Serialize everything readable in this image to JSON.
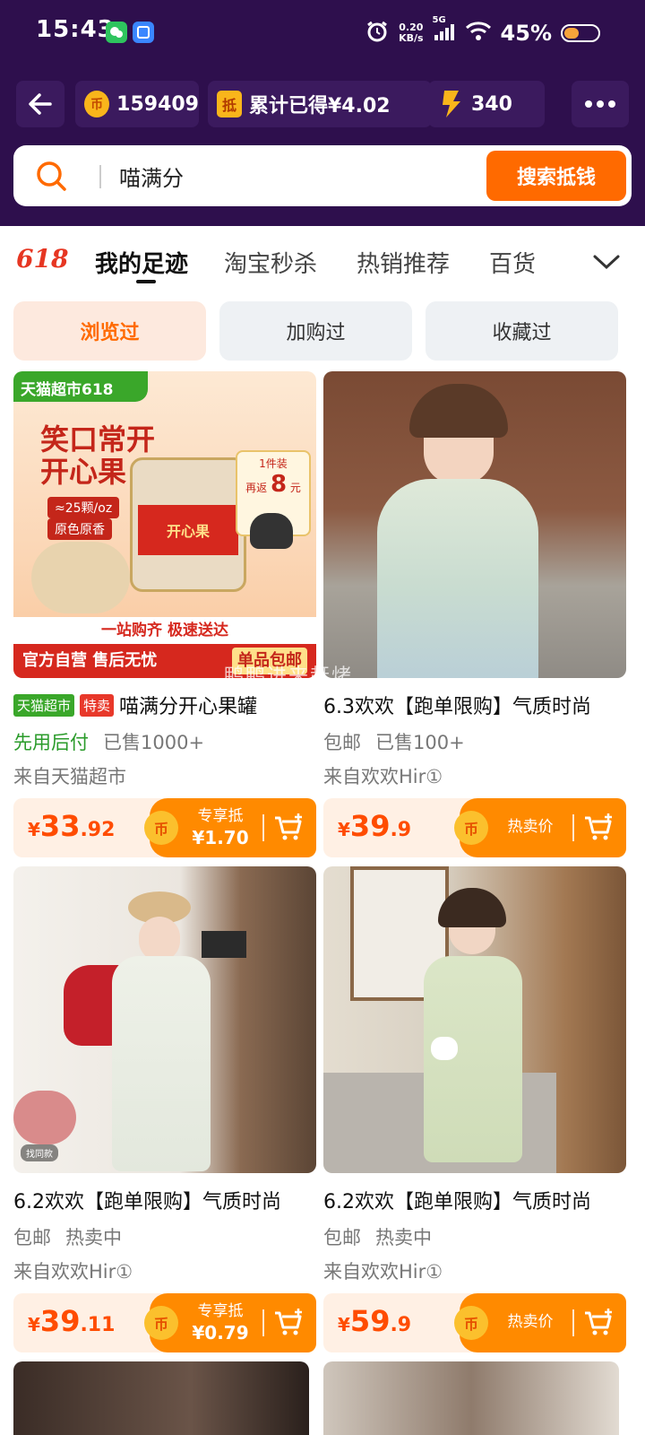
{
  "status_bar": {
    "time": "15:43",
    "speed_value": "0.20",
    "speed_unit": "KB/s",
    "network": "5G",
    "battery": "45%"
  },
  "header": {
    "coins": "159409",
    "coin_symbol": "币",
    "earned": "累计已得¥4.02",
    "earned_symbol": "抵",
    "gold": "340"
  },
  "search": {
    "value": "喵满分",
    "button": "搜索抵钱"
  },
  "tabs": {
    "promo": "618",
    "items": [
      "我的足迹",
      "淘宝秒杀",
      "热销推荐",
      "百货"
    ]
  },
  "filters": [
    "浏览过",
    "加购过",
    "收藏过"
  ],
  "watermark": "鸭鸭进来赶烤",
  "products": [
    {
      "badges": [
        "天猫超市",
        "特卖"
      ],
      "title": "喵满分开心果罐",
      "meta": [
        "先用后付",
        "已售1000+"
      ],
      "shop": "来自天猫超市",
      "price_yen": "¥",
      "price_int": "33",
      "price_dec": ".92",
      "deal_line1": "专享抵",
      "deal_line2": "¥1.70",
      "img_lines": [
        "天猫超市618",
        "笑口常开",
        "开心果",
        "≈25颗/oz",
        "原色原香",
        "1件装",
        "再返",
        "8",
        "元",
        "开心果",
        "一站购齐 极速送达",
        "官方自营 售后无忧",
        "单品包邮"
      ],
      "colors": {
        "accent": "#3aa72a"
      }
    },
    {
      "badges": [],
      "title": "6.3欢欢【跑单限购】气质时尚",
      "meta": [
        "包邮",
        "已售100+"
      ],
      "shop": "来自欢欢Hir①",
      "price_yen": "¥",
      "price_int": "39",
      "price_dec": ".9",
      "deal_line1": "热卖价",
      "deal_line2": ""
    },
    {
      "badges": [],
      "title": "6.2欢欢【跑单限购】气质时尚",
      "meta": [
        "包邮",
        "热卖中"
      ],
      "shop": "来自欢欢Hir①",
      "price_yen": "¥",
      "price_int": "39",
      "price_dec": ".11",
      "deal_line1": "专享抵",
      "deal_line2": "¥0.79",
      "img_tag": "找同款"
    },
    {
      "badges": [],
      "title": "6.2欢欢【跑单限购】气质时尚",
      "meta": [
        "包邮",
        "热卖中"
      ],
      "shop": "来自欢欢Hir①",
      "price_yen": "¥",
      "price_int": "59",
      "price_dec": ".9",
      "deal_line1": "热卖价",
      "deal_line2": ""
    }
  ],
  "colors": {
    "header_bg": "#2e0f4d",
    "accent_orange": "#ff6a00",
    "price_red": "#ff4c00"
  }
}
